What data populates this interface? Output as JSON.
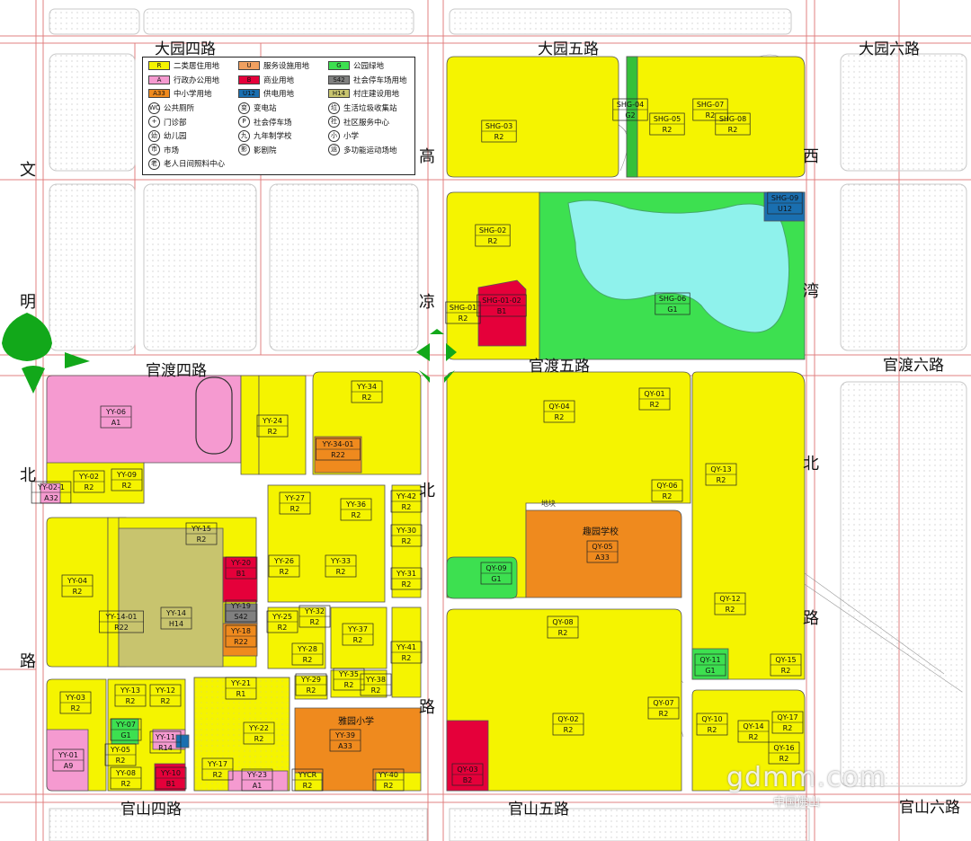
{
  "roads": {
    "dayuan4": "大园四路",
    "dayuan5": "大园五路",
    "dayuan6": "大园六路",
    "guandu4": "官渡四路",
    "guandu5": "官渡五路",
    "guandu6": "官渡六路",
    "guanshan4": "官山四路",
    "guanshan5": "官山五路",
    "guanshan6": "官山六路",
    "wenming_bei": [
      "文",
      "明",
      "北",
      "路"
    ],
    "gaoliang_bei": [
      "高",
      "凉",
      "北",
      "路"
    ],
    "xiwan_bei": [
      "西",
      "湾",
      "北",
      "路"
    ]
  },
  "legend": [
    {
      "code": "R",
      "label": "二类居住用地",
      "color": "#f5f400"
    },
    {
      "code": "A",
      "label": "行政办公用地",
      "color": "#f59ad0"
    },
    {
      "code": "A33",
      "label": "中小学用地",
      "color": "#ef8a1e"
    },
    {
      "code": "WC",
      "label": "公共厕所",
      "symbol": true
    },
    {
      "code": "+",
      "label": "门诊部",
      "symbol": true
    },
    {
      "code": "幼",
      "label": "幼儿园",
      "symbol": true
    },
    {
      "code": "市",
      "label": "市场",
      "symbol": true
    },
    {
      "code": "老",
      "label": "老人日间照料中心",
      "symbol": true
    },
    {
      "code": "U",
      "label": "服务设施用地",
      "color": "#f0a060"
    },
    {
      "code": "B",
      "label": "商业用地",
      "color": "#e5003a"
    },
    {
      "code": "U12",
      "label": "供电用地",
      "color": "#1a6fb0"
    },
    {
      "code": "变",
      "label": "变电站",
      "symbol": true
    },
    {
      "code": "P",
      "label": "社会停车场",
      "symbol": true
    },
    {
      "code": "九",
      "label": "九年制学校",
      "symbol": true
    },
    {
      "code": "影",
      "label": "影剧院",
      "symbol": true
    },
    {
      "code": "G",
      "label": "公园绿地",
      "color": "#3de050"
    },
    {
      "code": "S42",
      "label": "社会停车场用地",
      "color": "#808080"
    },
    {
      "code": "H14",
      "label": "村庄建设用地",
      "color": "#c8c46e"
    },
    {
      "code": "垃",
      "label": "生活垃圾收集站",
      "symbol": true
    },
    {
      "code": "社",
      "label": "社区服务中心",
      "symbol": true
    },
    {
      "code": "小",
      "label": "小学",
      "symbol": true
    },
    {
      "code": "运",
      "label": "多功能运动场地",
      "symbol": true
    }
  ],
  "parcels": [
    {
      "id": "SHG-03",
      "code": "R2"
    },
    {
      "id": "SHG-04",
      "code": "G2"
    },
    {
      "id": "SHG-05",
      "code": "R2"
    },
    {
      "id": "SHG-07",
      "code": "R2"
    },
    {
      "id": "SHG-08",
      "code": "R2"
    },
    {
      "id": "SHG-02",
      "code": "R2"
    },
    {
      "id": "SHG-01",
      "code": "R2"
    },
    {
      "id": "SHG-01-02",
      "code": "B1"
    },
    {
      "id": "SHG-06",
      "code": "G1"
    },
    {
      "id": "SHG-09",
      "code": "U12"
    },
    {
      "id": "YY-06",
      "code": "A1"
    },
    {
      "id": "YY-24",
      "code": "R2"
    },
    {
      "id": "YY-34",
      "code": "R2"
    },
    {
      "id": "YY-34-01",
      "code": "R22"
    },
    {
      "id": "YY-02",
      "code": "R2"
    },
    {
      "id": "YY-09",
      "code": "R2"
    },
    {
      "id": "YY-02-1",
      "code": "A32"
    },
    {
      "id": "YY-27",
      "code": "R2"
    },
    {
      "id": "YY-36",
      "code": "R2"
    },
    {
      "id": "YY-42",
      "code": "R2"
    },
    {
      "id": "YY-30",
      "code": "R2"
    },
    {
      "id": "YY-31",
      "code": "R2"
    },
    {
      "id": "YY-15",
      "code": "R2"
    },
    {
      "id": "YY-26",
      "code": "R2"
    },
    {
      "id": "YY-33",
      "code": "R2"
    },
    {
      "id": "YY-04",
      "code": "R2"
    },
    {
      "id": "YY-14-01",
      "code": "R22"
    },
    {
      "id": "YY-14",
      "code": "H14"
    },
    {
      "id": "YY-20",
      "code": "B1"
    },
    {
      "id": "YY-19",
      "code": "S42"
    },
    {
      "id": "YY-18",
      "code": "R22"
    },
    {
      "id": "YY-25",
      "code": "R2"
    },
    {
      "id": "YY-32",
      "code": "R2"
    },
    {
      "id": "YY-28",
      "code": "R2"
    },
    {
      "id": "YY-37",
      "code": "R2"
    },
    {
      "id": "YY-41",
      "code": "R2"
    },
    {
      "id": "YY-03",
      "code": "R2"
    },
    {
      "id": "YY-13",
      "code": "R2"
    },
    {
      "id": "YY-12",
      "code": "R2"
    },
    {
      "id": "YY-21",
      "code": "R1"
    },
    {
      "id": "YY-29",
      "code": "R2"
    },
    {
      "id": "YY-35",
      "code": "R2"
    },
    {
      "id": "YY-38",
      "code": "R2"
    },
    {
      "id": "YY-01",
      "code": "A9"
    },
    {
      "id": "YY-07",
      "code": "G1"
    },
    {
      "id": "YY-11",
      "code": "R14"
    },
    {
      "id": "YY-05",
      "code": "R2"
    },
    {
      "id": "YY-08",
      "code": "R2"
    },
    {
      "id": "YY-10",
      "code": "B1"
    },
    {
      "id": "YY-17",
      "code": "R2"
    },
    {
      "id": "YY-22",
      "code": "R2"
    },
    {
      "id": "YY-23",
      "code": "A1"
    },
    {
      "id": "YY-39",
      "code": "A33"
    },
    {
      "id": "YY-40",
      "code": "R2"
    },
    {
      "id": "YYCR",
      "code": "R2"
    },
    {
      "id": "QY-04",
      "code": "R2"
    },
    {
      "id": "QY-01",
      "code": "R2"
    },
    {
      "id": "QY-13",
      "code": "R2"
    },
    {
      "id": "QY-06",
      "code": "R2"
    },
    {
      "id": "QY-05",
      "code": "A33"
    },
    {
      "id": "QY-09",
      "code": "G1"
    },
    {
      "id": "QY-12",
      "code": "R2"
    },
    {
      "id": "QY-08",
      "code": "R2"
    },
    {
      "id": "QY-11",
      "code": "G1"
    },
    {
      "id": "QY-15",
      "code": "R2"
    },
    {
      "id": "QY-07",
      "code": "R2"
    },
    {
      "id": "QY-02",
      "code": "R2"
    },
    {
      "id": "QY-03",
      "code": "B2"
    },
    {
      "id": "QY-10",
      "code": "R2"
    },
    {
      "id": "QY-14",
      "code": "R2"
    },
    {
      "id": "QY-17",
      "code": "R2"
    },
    {
      "id": "QY-16",
      "code": "R2"
    }
  ],
  "schools": {
    "quyuan": "趣园学校",
    "yayuan": "雅园小学"
  },
  "misc": {
    "tiyu": "地块"
  },
  "watermark": "gdmm.com",
  "watermark_sub": "中国佛山"
}
